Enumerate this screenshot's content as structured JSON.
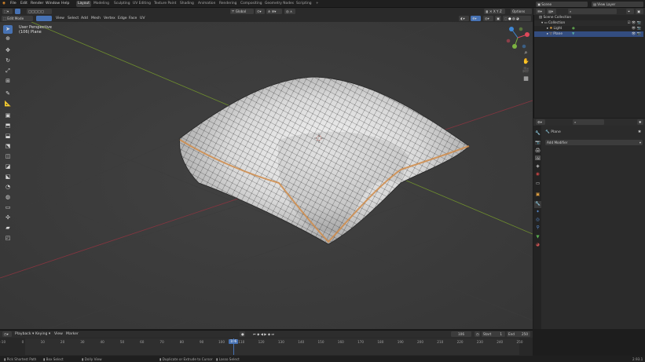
{
  "topbar": {
    "menus": [
      "File",
      "Edit",
      "Render",
      "Window",
      "Help"
    ],
    "workspaces": [
      "Layout",
      "Modeling",
      "Sculpting",
      "UV Editing",
      "Texture Paint",
      "Shading",
      "Animation",
      "Rendering",
      "Compositing",
      "Geometry Nodes",
      "Scripting"
    ],
    "active_workspace": "Layout",
    "add_tab": "+",
    "scene_name": "Scene",
    "view_layer": "View Layer"
  },
  "viewport_header": {
    "mode": "Edit Mode",
    "menus": [
      "View",
      "Select",
      "Add",
      "Mesh",
      "Vertex",
      "Edge",
      "Face",
      "UV"
    ],
    "orientation": "Global",
    "options": "Options"
  },
  "viewport": {
    "perspective_label": "User Perspective",
    "object_label": "(106) Plane",
    "gizmo_axes": [
      "X",
      "Y",
      "Z"
    ]
  },
  "outliner": {
    "root": "Scene Collection",
    "items": [
      {
        "label": "Collection",
        "depth": 1,
        "selected": false
      },
      {
        "label": "Light",
        "depth": 2,
        "selected": false
      },
      {
        "label": "Plane",
        "depth": 2,
        "selected": true
      }
    ]
  },
  "properties": {
    "object_name": "Plane",
    "add_modifier": "Add Modifier"
  },
  "timeline": {
    "menus": [
      "Playback",
      "Keying",
      "View",
      "Marker"
    ],
    "current_frame": "106",
    "start_label": "Start",
    "start_value": "1",
    "end_label": "End",
    "end_value": "250",
    "ruler": [
      "-10",
      "0",
      "10",
      "20",
      "30",
      "40",
      "50",
      "60",
      "70",
      "80",
      "90",
      "100",
      "106",
      "110",
      "120",
      "130",
      "140",
      "150",
      "160",
      "170",
      "180",
      "190",
      "200",
      "210",
      "220",
      "230",
      "240",
      "250"
    ],
    "playhead_frame": 106
  },
  "statusbar": {
    "items": [
      "Pick Shortest Path",
      "Box Select",
      "Dolly View",
      "Duplicate or Extrude to Cursor",
      "Lasso Select"
    ],
    "version": "2.93.1"
  },
  "colors": {
    "accent": "#4772b3",
    "x_axis": "#e0485a",
    "y_axis": "#7cb342",
    "z_axis": "#3f87d4",
    "seam": "#d08c4a"
  }
}
